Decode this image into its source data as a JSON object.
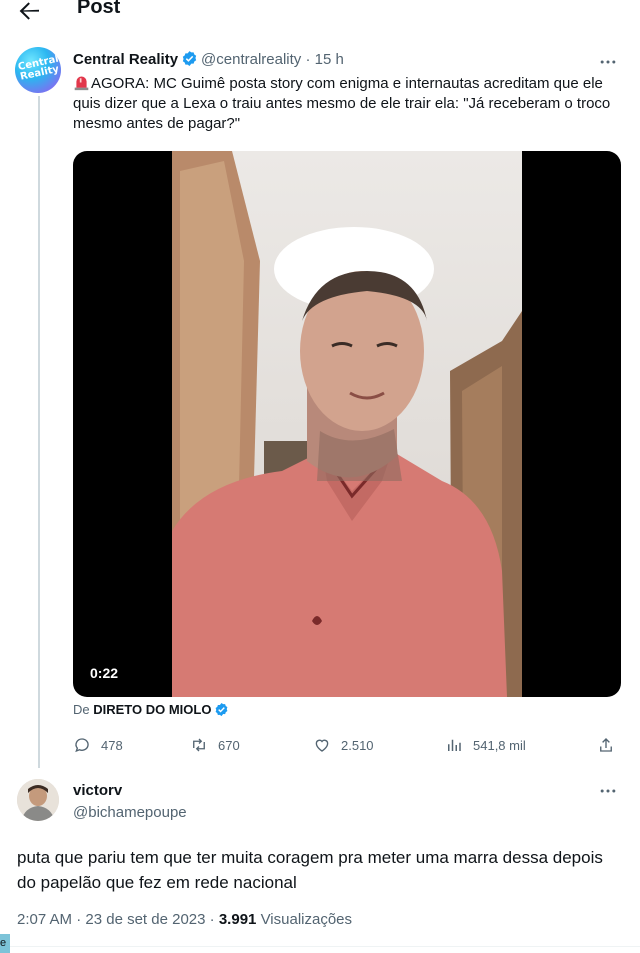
{
  "header": {
    "title": "Post"
  },
  "tweet": {
    "author_name": "Central Reality",
    "avatar_text": "Central Reality",
    "handle": "@centralreality",
    "separator": "·",
    "time": "15 h",
    "text": "AGORA: MC Guimê posta story com enigma e internautas acreditam que ele quis dizer que a Lexa o traiu antes mesmo de ele trair ela: \"Já receberam o troco mesmo antes de pagar?\"",
    "video_duration": "0:22",
    "from_prefix": "De",
    "from_name": "DIRETO DO MIOLO",
    "stats": {
      "replies": "478",
      "reposts": "670",
      "likes": "2.510",
      "views": "541,8 mil"
    }
  },
  "reply": {
    "author_name": "victorv",
    "handle": "@bichamepoupe",
    "text": "puta que pariu tem que ter muita coragem pra meter uma marra dessa depois do papelão que fez em rede nacional",
    "time": "2:07 AM",
    "dot": "·",
    "date": "23 de set de 2023",
    "views_count": "3.991",
    "views_label": "Visualizações"
  },
  "edge_tab": {
    "label": "e"
  },
  "colors": {
    "text": "#0f1419",
    "muted": "#536471",
    "verified": "#1d9bf0",
    "thread_line": "#cfd9de",
    "shirt": "#d67a73"
  }
}
